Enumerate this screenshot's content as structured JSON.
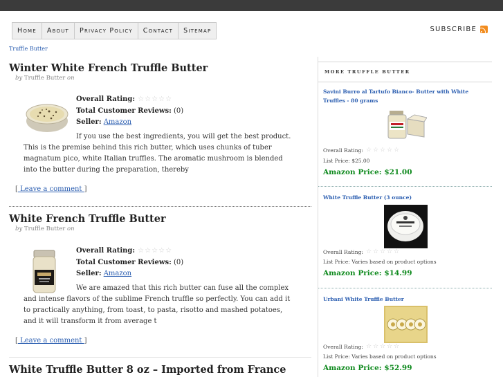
{
  "nav": {
    "items": [
      {
        "label": "Home"
      },
      {
        "label": "About"
      },
      {
        "label": "Privacy Policy"
      },
      {
        "label": "Contact"
      },
      {
        "label": "Sitemap"
      }
    ]
  },
  "header": {
    "subscribe_label": "SUBSCRIBE"
  },
  "breadcrumb": {
    "text": "Truffle Butter"
  },
  "posts": [
    {
      "title": "Winter White French Truffle Butter",
      "by_prefix": "by",
      "author": "Truffle Butter",
      "on_label": "on",
      "overall_rating_label": "Overall Rating:",
      "total_reviews_label": "Total Customer Reviews:",
      "total_reviews_value": "(0)",
      "seller_label": "Seller:",
      "seller_link": "Amazon",
      "description": "If you use the best ingredients, you will get the best product. This is the premise behind this rich butter, which uses chunks of tuber magnatum pico, white Italian truffles. The aromatic mushroom is blended into the butter during the preparation, thereby",
      "comment_open": "[",
      "comment_link": " Leave a comment ",
      "comment_close": "]"
    },
    {
      "title": "White French Truffle Butter",
      "by_prefix": "by",
      "author": "Truffle Butter",
      "on_label": "on",
      "overall_rating_label": "Overall Rating:",
      "total_reviews_label": "Total Customer Reviews:",
      "total_reviews_value": "(0)",
      "seller_label": "Seller:",
      "seller_link": "Amazon",
      "description": "We are amazed that this rich butter can fuse all the complex and intense flavors of the sublime French truffle so perfectly. You can add it to practically anything, from toast, to pasta, risotto and mashed potatoes, and it will transform it from average t",
      "comment_open": "[",
      "comment_link": " Leave a comment ",
      "comment_close": "]"
    },
    {
      "title": "White Truffle Butter 8 oz – Imported from France"
    }
  ],
  "sidebar": {
    "heading": "MORE TRUFFLE BUTTER",
    "items": [
      {
        "title": "Savini Burro al Tartufo Bianco- Butter with White Truffles - 80 grams",
        "overall_rating_label": "Overall Rating:",
        "list_price": "List Price: $25.00",
        "amazon_price": "Amazon Price: $21.00"
      },
      {
        "title": "White Truffle Butter (3 ounce)",
        "overall_rating_label": "Overall Rating:",
        "list_price": "List Price: Varies based on product options",
        "amazon_price": "Amazon Price: $14.99"
      },
      {
        "title": "Urbani White Truffle Butter",
        "overall_rating_label": "Overall Rating:",
        "list_price": "List Price: Varies based on product options",
        "amazon_price": "Amazon Price: $52.99"
      }
    ]
  },
  "colors": {
    "topbar": "#3b3b3b",
    "link": "#2a5db0",
    "price_green": "#0f8a1e",
    "rss_orange": "#f28c1e"
  }
}
